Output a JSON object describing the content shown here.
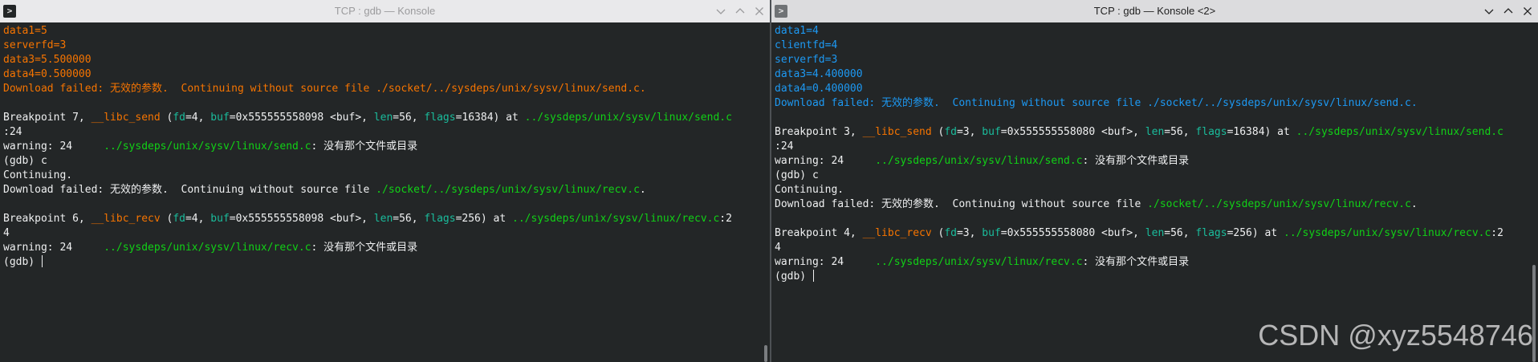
{
  "left_window": {
    "title": "TCP : gdb — Konsole",
    "lines": [
      [
        [
          "data1=5",
          "o"
        ]
      ],
      [
        [
          "serverfd=3",
          "o"
        ]
      ],
      [
        [
          "data3=5.500000",
          "o"
        ]
      ],
      [
        [
          "data4=0.500000",
          "o"
        ]
      ],
      [
        [
          "Download failed: 无效的参数.  Continuing without source file ./socket/../sysdeps/unix/sysv/linux/send.c.",
          "o"
        ]
      ],
      [],
      [
        [
          "Breakpoint 7, ",
          "w"
        ],
        [
          "__libc_send",
          "o"
        ],
        [
          " (",
          "w"
        ],
        [
          "fd",
          "c"
        ],
        [
          "=4, ",
          "w"
        ],
        [
          "buf",
          "c"
        ],
        [
          "=0x555555558098 <buf>, ",
          "w"
        ],
        [
          "len",
          "c"
        ],
        [
          "=56, ",
          "w"
        ],
        [
          "flags",
          "c"
        ],
        [
          "=16384) at ",
          "w"
        ],
        [
          "../sysdeps/unix/sysv/linux/send.c",
          "g"
        ]
      ],
      [
        [
          ":24",
          "w"
        ]
      ],
      [
        [
          "warning: 24     ",
          "w"
        ],
        [
          "../sysdeps/unix/sysv/linux/send.c",
          "g"
        ],
        [
          ": 没有那个文件或目录",
          "w"
        ]
      ],
      [
        [
          "(gdb) c",
          "w"
        ]
      ],
      [
        [
          "Continuing.",
          "w"
        ]
      ],
      [
        [
          "Download failed: 无效的参数.  Continuing without source file ",
          "w"
        ],
        [
          "./socket/../sysdeps/unix/sysv/linux/recv.c",
          "g"
        ],
        [
          ".",
          "w"
        ]
      ],
      [],
      [
        [
          "Breakpoint 6, ",
          "w"
        ],
        [
          "__libc_recv",
          "o"
        ],
        [
          " (",
          "w"
        ],
        [
          "fd",
          "c"
        ],
        [
          "=4, ",
          "w"
        ],
        [
          "buf",
          "c"
        ],
        [
          "=0x555555558098 <buf>, ",
          "w"
        ],
        [
          "len",
          "c"
        ],
        [
          "=56, ",
          "w"
        ],
        [
          "flags",
          "c"
        ],
        [
          "=256) at ",
          "w"
        ],
        [
          "../sysdeps/unix/sysv/linux/recv.c",
          "g"
        ],
        [
          ":2",
          "w"
        ]
      ],
      [
        [
          "4",
          "w"
        ]
      ],
      [
        [
          "warning: 24     ",
          "w"
        ],
        [
          "../sysdeps/unix/sysv/linux/recv.c",
          "g"
        ],
        [
          ": 没有那个文件或目录",
          "w"
        ]
      ],
      [
        [
          "(gdb) ",
          "w"
        ]
      ]
    ]
  },
  "right_window": {
    "title": "TCP : gdb — Konsole <2>",
    "lines": [
      [
        [
          "data1=4",
          "b"
        ]
      ],
      [
        [
          "clientfd=4",
          "b"
        ]
      ],
      [
        [
          "serverfd=3",
          "b"
        ]
      ],
      [
        [
          "data3=4.400000",
          "b"
        ]
      ],
      [
        [
          "data4=0.400000",
          "b"
        ]
      ],
      [
        [
          "Download failed: 无效的参数.  Continuing without source file ./socket/../sysdeps/unix/sysv/linux/send.c.",
          "b"
        ]
      ],
      [],
      [
        [
          "Breakpoint 3, ",
          "w"
        ],
        [
          "__libc_send",
          "o"
        ],
        [
          " (",
          "w"
        ],
        [
          "fd",
          "c"
        ],
        [
          "=3, ",
          "w"
        ],
        [
          "buf",
          "c"
        ],
        [
          "=0x555555558080 <buf>, ",
          "w"
        ],
        [
          "len",
          "c"
        ],
        [
          "=56, ",
          "w"
        ],
        [
          "flags",
          "c"
        ],
        [
          "=16384) at ",
          "w"
        ],
        [
          "../sysdeps/unix/sysv/linux/send.c",
          "g"
        ]
      ],
      [
        [
          ":24",
          "w"
        ]
      ],
      [
        [
          "warning: 24     ",
          "w"
        ],
        [
          "../sysdeps/unix/sysv/linux/send.c",
          "g"
        ],
        [
          ": 没有那个文件或目录",
          "w"
        ]
      ],
      [
        [
          "(gdb) c",
          "w"
        ]
      ],
      [
        [
          "Continuing.",
          "w"
        ]
      ],
      [
        [
          "Download failed: 无效的参数.  Continuing without source file ",
          "w"
        ],
        [
          "./socket/../sysdeps/unix/sysv/linux/recv.c",
          "g"
        ],
        [
          ".",
          "w"
        ]
      ],
      [],
      [
        [
          "Breakpoint 4, ",
          "w"
        ],
        [
          "__libc_recv",
          "o"
        ],
        [
          " (",
          "w"
        ],
        [
          "fd",
          "c"
        ],
        [
          "=3, ",
          "w"
        ],
        [
          "buf",
          "c"
        ],
        [
          "=0x555555558080 <buf>, ",
          "w"
        ],
        [
          "len",
          "c"
        ],
        [
          "=56, ",
          "w"
        ],
        [
          "flags",
          "c"
        ],
        [
          "=256) at ",
          "w"
        ],
        [
          "../sysdeps/unix/sysv/linux/recv.c",
          "g"
        ],
        [
          ":2",
          "w"
        ]
      ],
      [
        [
          "4",
          "w"
        ]
      ],
      [
        [
          "warning: 24     ",
          "w"
        ],
        [
          "../sysdeps/unix/sysv/linux/recv.c",
          "g"
        ],
        [
          ": 没有那个文件或目录",
          "w"
        ]
      ],
      [
        [
          "(gdb) ",
          "w"
        ]
      ]
    ]
  },
  "icons": {
    "app": "konsole-icon",
    "minimize": "chevron-down-icon",
    "maximize": "chevron-up-icon",
    "close": "close-icon"
  },
  "watermark": "CSDN @xyz5548746",
  "colors": {
    "background": "#232627",
    "orange": "#f67400",
    "green": "#11d116",
    "blue": "#1d99f3",
    "cyan": "#1abc9c",
    "text": "#eff0f1"
  }
}
